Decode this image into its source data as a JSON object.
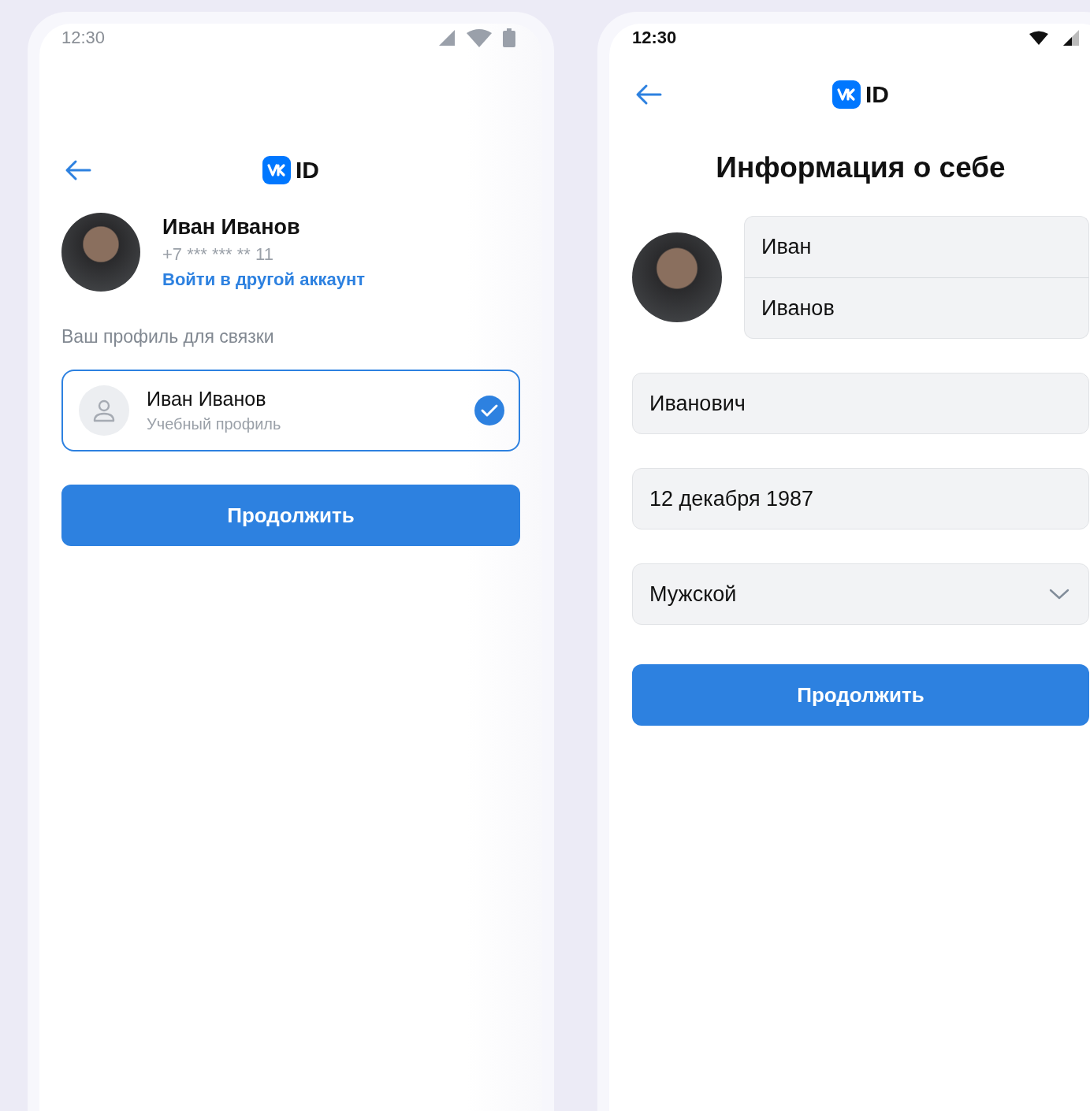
{
  "screen_1": {
    "status_bar": {
      "time": "12:30"
    },
    "header": {
      "logo_text": "ID"
    },
    "user": {
      "name": "Иван Иванов",
      "phone": "+7 *** *** ** 11",
      "switch_link": "Войти в другой аккаунт"
    },
    "section_label": "Ваш профиль для связки",
    "profiles": [
      {
        "name": "Иван Иванов",
        "subtitle": "Учебный профиль",
        "selected": true
      }
    ],
    "button": "Продолжить"
  },
  "screen_2": {
    "status_bar": {
      "time": "12:30"
    },
    "header": {
      "logo_text": "ID"
    },
    "title": "Информация о себе",
    "name_fields": [
      {
        "value": "Иван"
      },
      {
        "value": "Иванов"
      }
    ],
    "fields": [
      {
        "kind": "text",
        "value": "Иванович"
      },
      {
        "kind": "text",
        "value": "12 декабря 1987"
      },
      {
        "kind": "select",
        "value": "Мужской"
      }
    ],
    "button": "Продолжить"
  }
}
